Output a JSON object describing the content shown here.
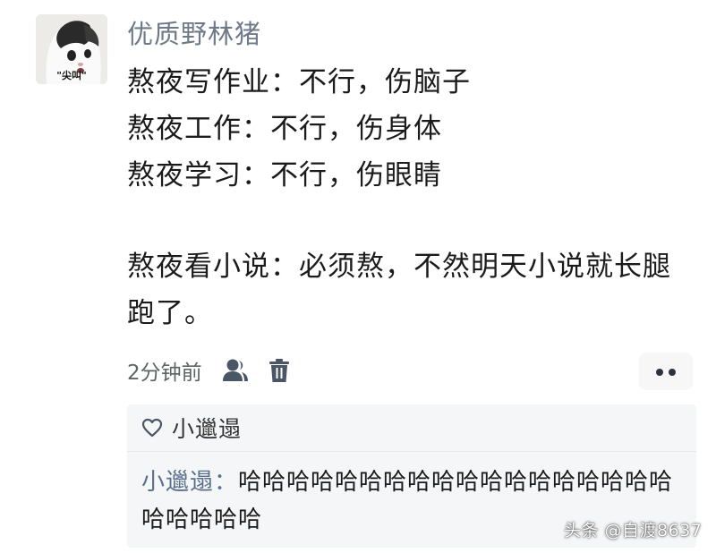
{
  "post": {
    "avatar": {
      "caption": "\"尖叫\""
    },
    "username": "优质野林猪",
    "lines": [
      "熬夜写作业：不行，伤脑子",
      "熬夜工作：不行，伤身体",
      "熬夜学习：不行，伤眼睛",
      "熬夜看小说：必须熬，不然明天小说就长腿",
      "跑了。"
    ],
    "time": "2分钟前",
    "icons": {
      "user": "user-icon",
      "delete": "trash-icon",
      "more": "more-dots-icon",
      "like": "heart-icon"
    }
  },
  "likes": {
    "user": "小邋遢"
  },
  "reply": {
    "author": "小邋遢：",
    "text": "哈哈哈哈哈哈哈哈哈哈哈哈哈哈哈哈哈哈哈哈哈哈哈"
  },
  "watermark": "头条 @自渡8637",
  "colors": {
    "username": "#6e7a88",
    "text": "#1b1b1b",
    "reply_author": "#5a6f8c",
    "reply_bg": "#f5f6f7"
  }
}
